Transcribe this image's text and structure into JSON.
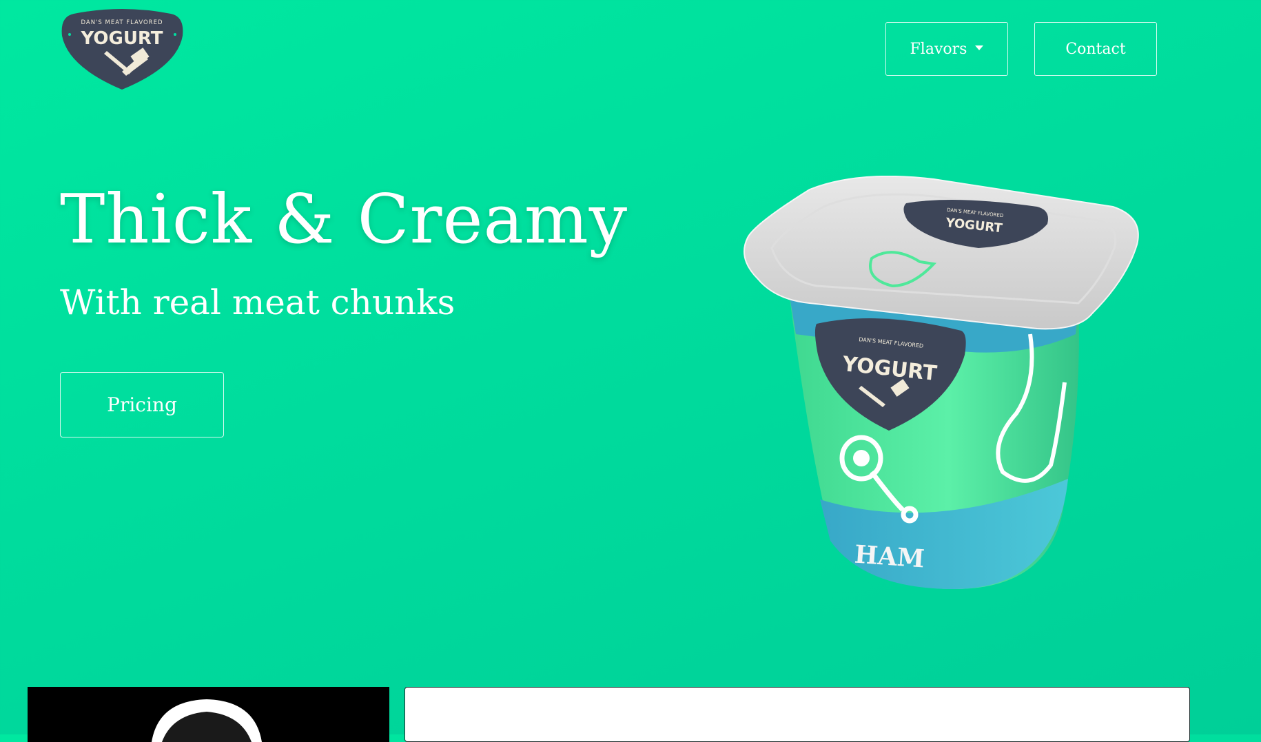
{
  "logo": {
    "tagline": "DAN'S MEAT FLAVORED",
    "brand": "YOGURT",
    "icon": "crossed-knives-icon"
  },
  "nav": {
    "flavors_label": "Flavors",
    "contact_label": "Contact"
  },
  "hero": {
    "title": "Thick & Creamy",
    "subtitle": "With real meat chunks",
    "pricing_label": "Pricing"
  },
  "product": {
    "lid_tagline": "DAN'S MEAT FLAVORED",
    "lid_brand": "YOGURT",
    "cup_tagline": "DAN'S MEAT FLAVORED",
    "cup_brand": "YOGURT",
    "flavor": "HAM"
  },
  "colors": {
    "background": "#00e0a0",
    "badge": "#3d4558",
    "cup_green": "#4fe89a",
    "cup_blue": "#3cc0d0"
  }
}
